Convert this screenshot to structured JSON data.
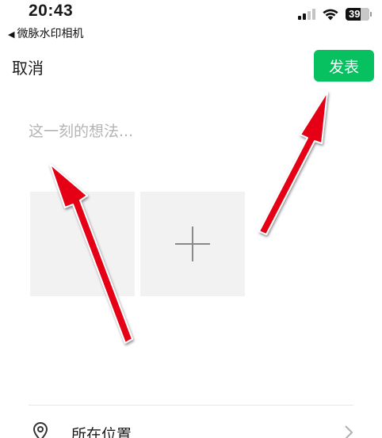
{
  "status_bar": {
    "time": "20:43",
    "back_app": "微脉水印相机",
    "battery_level": "39",
    "icons": [
      "signal-icon",
      "wifi-icon",
      "battery-icon"
    ]
  },
  "nav": {
    "cancel_label": "取消",
    "publish_label": "发表"
  },
  "composer": {
    "placeholder": "这一刻的想法...",
    "value": ""
  },
  "media": {
    "add_icon": "plus-icon"
  },
  "location": {
    "label": "所在位置",
    "icon": "location-pin-icon",
    "chevron": "chevron-right-icon"
  },
  "colors": {
    "publish_button": "#07c160",
    "annotation_arrow": "#e60012",
    "tile_background": "#f2f2f2",
    "placeholder_text": "#b4b4b4"
  }
}
